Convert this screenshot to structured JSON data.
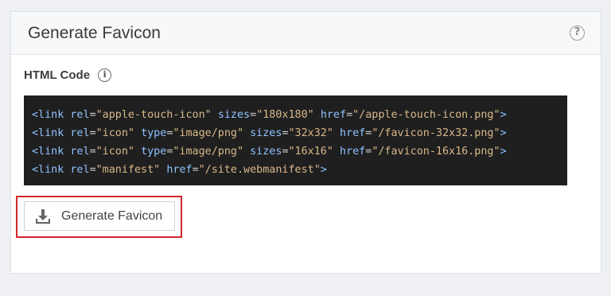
{
  "panel": {
    "title": "Generate Favicon",
    "help_icon": "question-circle-icon",
    "help_glyph": "?"
  },
  "code_section": {
    "label": "HTML Code",
    "info_icon": "info-circle-icon",
    "info_glyph": "i",
    "lines": [
      [
        {
          "t": "tag",
          "v": "<link"
        },
        {
          "t": "sp",
          "v": " "
        },
        {
          "t": "attr",
          "v": "rel"
        },
        {
          "t": "punct",
          "v": "="
        },
        {
          "t": "val",
          "v": "\"apple-touch-icon\""
        },
        {
          "t": "sp",
          "v": " "
        },
        {
          "t": "attr",
          "v": "sizes"
        },
        {
          "t": "punct",
          "v": "="
        },
        {
          "t": "val",
          "v": "\"180x180\""
        },
        {
          "t": "sp",
          "v": " "
        },
        {
          "t": "attr",
          "v": "href"
        },
        {
          "t": "punct",
          "v": "="
        },
        {
          "t": "val",
          "v": "\"/apple-touch-icon.png\""
        },
        {
          "t": "tag",
          "v": ">"
        }
      ],
      [
        {
          "t": "tag",
          "v": "<link"
        },
        {
          "t": "sp",
          "v": " "
        },
        {
          "t": "attr",
          "v": "rel"
        },
        {
          "t": "punct",
          "v": "="
        },
        {
          "t": "val",
          "v": "\"icon\""
        },
        {
          "t": "sp",
          "v": " "
        },
        {
          "t": "attr",
          "v": "type"
        },
        {
          "t": "punct",
          "v": "="
        },
        {
          "t": "val",
          "v": "\"image/png\""
        },
        {
          "t": "sp",
          "v": " "
        },
        {
          "t": "attr",
          "v": "sizes"
        },
        {
          "t": "punct",
          "v": "="
        },
        {
          "t": "val",
          "v": "\"32x32\""
        },
        {
          "t": "sp",
          "v": " "
        },
        {
          "t": "attr",
          "v": "href"
        },
        {
          "t": "punct",
          "v": "="
        },
        {
          "t": "val",
          "v": "\"/favicon-32x32.png\""
        },
        {
          "t": "tag",
          "v": ">"
        }
      ],
      [
        {
          "t": "tag",
          "v": "<link"
        },
        {
          "t": "sp",
          "v": " "
        },
        {
          "t": "attr",
          "v": "rel"
        },
        {
          "t": "punct",
          "v": "="
        },
        {
          "t": "val",
          "v": "\"icon\""
        },
        {
          "t": "sp",
          "v": " "
        },
        {
          "t": "attr",
          "v": "type"
        },
        {
          "t": "punct",
          "v": "="
        },
        {
          "t": "val",
          "v": "\"image/png\""
        },
        {
          "t": "sp",
          "v": " "
        },
        {
          "t": "attr",
          "v": "sizes"
        },
        {
          "t": "punct",
          "v": "="
        },
        {
          "t": "val",
          "v": "\"16x16\""
        },
        {
          "t": "sp",
          "v": " "
        },
        {
          "t": "attr",
          "v": "href"
        },
        {
          "t": "punct",
          "v": "="
        },
        {
          "t": "val",
          "v": "\"/favicon-16x16.png\""
        },
        {
          "t": "tag",
          "v": ">"
        }
      ],
      [
        {
          "t": "tag",
          "v": "<link"
        },
        {
          "t": "sp",
          "v": " "
        },
        {
          "t": "attr",
          "v": "rel"
        },
        {
          "t": "punct",
          "v": "="
        },
        {
          "t": "val",
          "v": "\"manifest\""
        },
        {
          "t": "sp",
          "v": " "
        },
        {
          "t": "attr",
          "v": "href"
        },
        {
          "t": "punct",
          "v": "="
        },
        {
          "t": "val",
          "v": "\"/site.webmanifest\""
        },
        {
          "t": "tag",
          "v": ">"
        }
      ]
    ]
  },
  "generate_button": {
    "label": "Generate Favicon",
    "icon": "download-icon"
  },
  "colors": {
    "highlight_border": "#d3262e",
    "code_background": "#1f1f1f",
    "code_tag": "#8ec2ff",
    "code_value": "#d9b88a"
  }
}
